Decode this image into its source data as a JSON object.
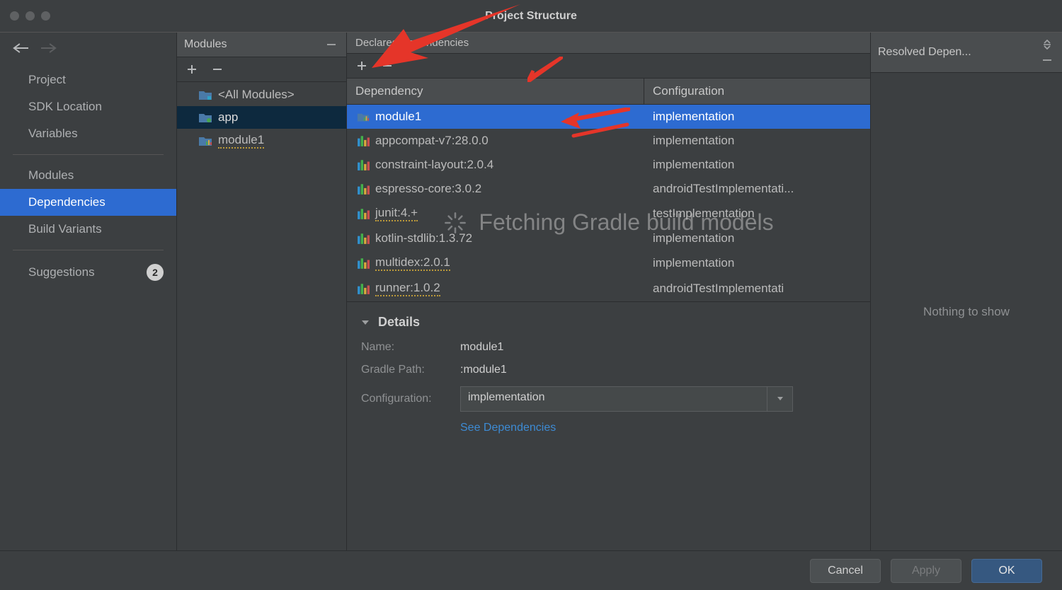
{
  "window": {
    "title": "Project Structure"
  },
  "nav": {
    "items": [
      {
        "label": "Project"
      },
      {
        "label": "SDK Location"
      },
      {
        "label": "Variables"
      },
      {
        "label": "Modules"
      },
      {
        "label": "Dependencies",
        "selected": true
      },
      {
        "label": "Build Variants"
      },
      {
        "label": "Suggestions",
        "badge": "2"
      }
    ]
  },
  "modules": {
    "title": "Modules",
    "items": [
      {
        "label": "<All Modules>"
      },
      {
        "label": "app",
        "selected": true
      },
      {
        "label": "module1"
      }
    ]
  },
  "deps": {
    "title": "Declared Dependencies",
    "columns": {
      "dep": "Dependency",
      "conf": "Configuration"
    },
    "rows": [
      {
        "name": "module1",
        "conf": "implementation",
        "icon": "module",
        "selected": true
      },
      {
        "name": "appcompat-v7:28.0.0",
        "conf": "implementation",
        "icon": "lib"
      },
      {
        "name": "constraint-layout:2.0.4",
        "conf": "implementation",
        "icon": "lib"
      },
      {
        "name": "espresso-core:3.0.2",
        "conf": "androidTestImplementati...",
        "icon": "lib"
      },
      {
        "name": "junit:4.+",
        "conf": "testImplementation",
        "icon": "lib",
        "wavy": true
      },
      {
        "name": "kotlin-stdlib:1.3.72",
        "conf": "implementation",
        "icon": "lib"
      },
      {
        "name": "multidex:2.0.1",
        "conf": "implementation",
        "icon": "lib",
        "wavy": true
      },
      {
        "name": "runner:1.0.2",
        "conf": "androidTestImplementati",
        "icon": "lib",
        "wavy": true
      }
    ]
  },
  "overlay": {
    "text": "Fetching Gradle build models"
  },
  "details": {
    "title": "Details",
    "name_label": "Name:",
    "name_value": "module1",
    "path_label": "Gradle Path:",
    "path_value": ":module1",
    "config_label": "Configuration:",
    "config_value": "implementation",
    "link": "See Dependencies"
  },
  "resolved": {
    "title": "Resolved Depen...",
    "empty": "Nothing to show"
  },
  "buttons": {
    "cancel": "Cancel",
    "apply": "Apply",
    "ok": "OK"
  }
}
